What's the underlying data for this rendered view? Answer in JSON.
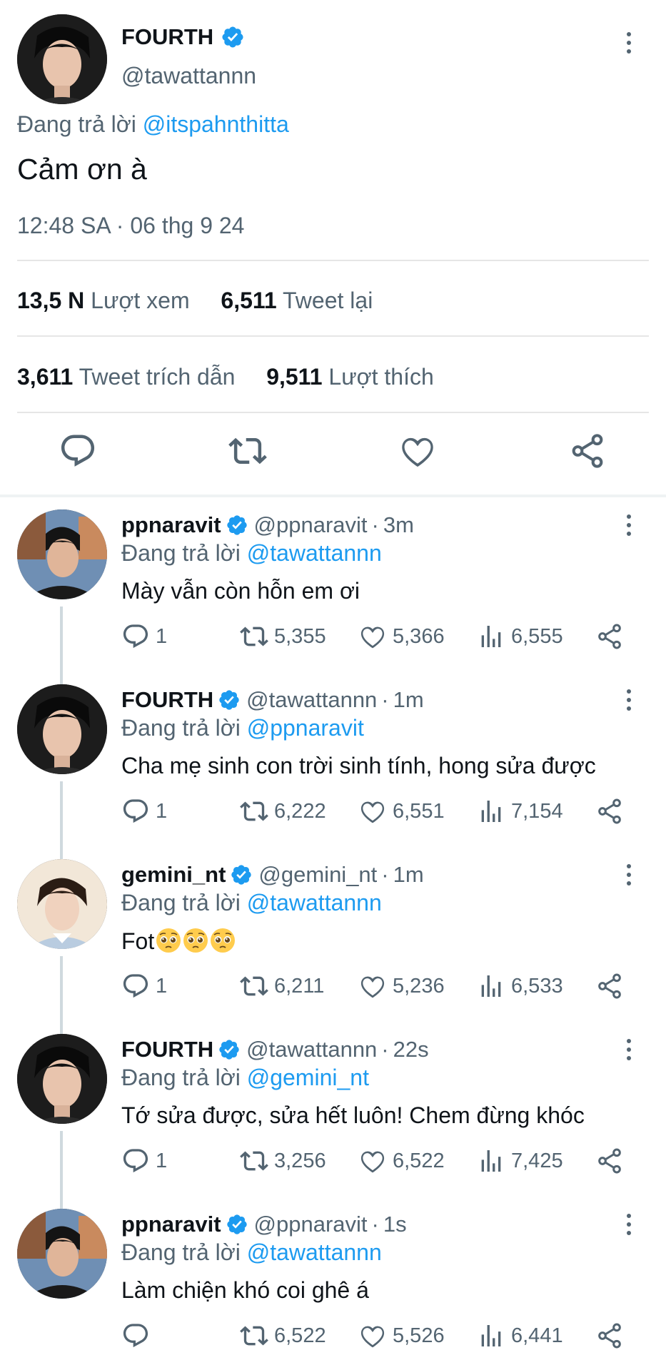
{
  "main": {
    "name": "FOURTH",
    "handle": "@tawattannn",
    "replying_prefix": "Đang trả lời",
    "replying_to": "@itspahnthitta",
    "text": "Cảm ơn à",
    "timestamp": "12:48 SA · 06 thg 9 24",
    "views_count": "13,5 N",
    "views_label": "Lượt xem",
    "retweets_count": "6,511",
    "retweets_label": "Tweet lại",
    "quotes_count": "3,611",
    "quotes_label": "Tweet trích dẫn",
    "likes_count": "9,511",
    "likes_label": "Lượt thích",
    "actions": [
      "reply-icon",
      "retweet-icon",
      "like-icon",
      "share-icon"
    ]
  },
  "replies": [
    {
      "name": "ppnaravit",
      "handle": "@ppnaravit",
      "time": "3m",
      "replying_prefix": "Đang trả lời",
      "replying_to": "@tawattannn",
      "text": "Mày vẫn còn hỗn em ơi",
      "reply_count": "1",
      "retweet_count": "5,355",
      "like_count": "5,366",
      "view_count": "6,555",
      "avatar": "ppnaravit"
    },
    {
      "name": "FOURTH",
      "handle": "@tawattannn",
      "time": "1m",
      "replying_prefix": "Đang trả lời",
      "replying_to": "@ppnaravit",
      "text": "Cha mẹ sinh con trời sinh tính, hong sửa được",
      "reply_count": "1",
      "retweet_count": "6,222",
      "like_count": "6,551",
      "view_count": "7,154",
      "avatar": "fourth"
    },
    {
      "name": "gemini_nt",
      "handle": "@gemini_nt",
      "time": "1m",
      "replying_prefix": "Đang trả lời",
      "replying_to": "@tawattannn",
      "text": "Fot",
      "emoji": [
        "pleading-face",
        "pleading-face",
        "pleading-face"
      ],
      "reply_count": "1",
      "retweet_count": "6,211",
      "like_count": "5,236",
      "view_count": "6,533",
      "avatar": "gemini"
    },
    {
      "name": "FOURTH",
      "handle": "@tawattannn",
      "time": "22s",
      "replying_prefix": "Đang trả lời",
      "replying_to": "@gemini_nt",
      "text": "Tớ sửa được, sửa hết luôn! Chem đừng khóc",
      "reply_count": "1",
      "retweet_count": "3,256",
      "like_count": "6,522",
      "view_count": "7,425",
      "avatar": "fourth"
    },
    {
      "name": "ppnaravit",
      "handle": "@ppnaravit",
      "time": "1s",
      "replying_prefix": "Đang trả lời",
      "replying_to": "@tawattannn",
      "text": "Làm chiện khó coi ghê á",
      "reply_count": "",
      "retweet_count": "6,522",
      "like_count": "5,526",
      "view_count": "6,441",
      "avatar": "ppnaravit"
    }
  ],
  "colors": {
    "accent": "#1d9bf0",
    "secondary_text": "#536471",
    "primary_text": "#0f1419",
    "divider": "#e6e6e6"
  }
}
